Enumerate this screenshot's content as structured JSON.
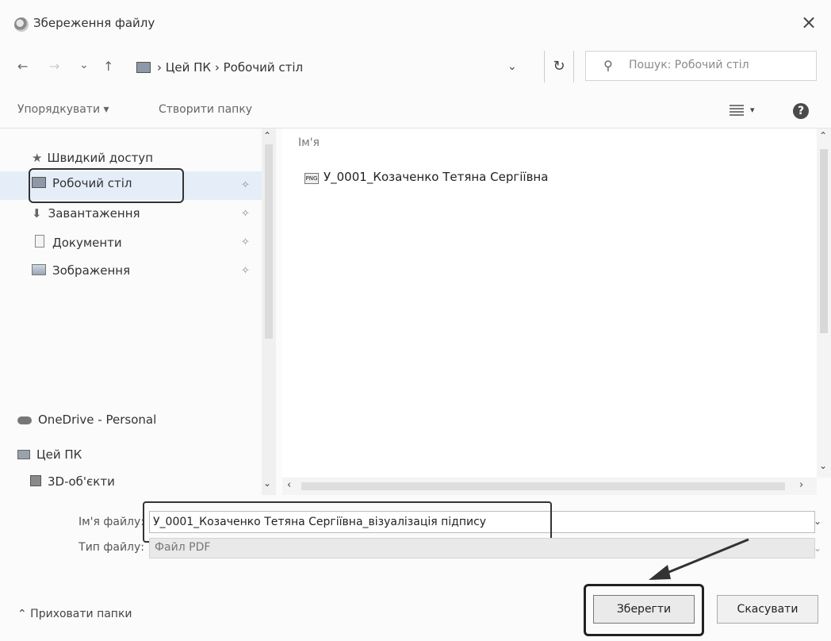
{
  "window": {
    "title": "Збереження файлу",
    "close_glyph": "×"
  },
  "nav": {
    "back_glyph": "←",
    "forward_glyph": "→",
    "recent_glyph": "⌄",
    "up_glyph": "↑",
    "path_text": "› Цей ПК › Робочий стіл",
    "path_dropdown_glyph": "⌄",
    "refresh_glyph": "↻"
  },
  "search": {
    "placeholder": "Пошук: Робочий стіл",
    "icon_glyph": "⚲"
  },
  "toolbar": {
    "organize_label": "Упорядкувати ▾",
    "new_folder_label": "Створити папку",
    "view_dropdown_glyph": "▾",
    "help_glyph": "?"
  },
  "navpane": {
    "quick_access": "Швидкий доступ",
    "items": [
      {
        "label": "Робочий стіл"
      },
      {
        "label": "Завантаження"
      },
      {
        "label": "Документи"
      },
      {
        "label": "Зображення"
      }
    ],
    "pin_glyph": "✧",
    "onedrive": "OneDrive - Personal",
    "this_pc": "Цей ПК",
    "objects_3d": "3D-об'єкти",
    "scroll_up_glyph": "⌃",
    "scroll_down_glyph": "⌄"
  },
  "filelist": {
    "column_name": "Ім'я",
    "files": [
      {
        "name": "У_0001_Козаченко Тетяна Сергіївна",
        "icon_text": "PNG"
      }
    ],
    "scroll_up_glyph": "⌃",
    "scroll_down_glyph": "⌄",
    "scroll_left_glyph": "‹",
    "scroll_right_glyph": "›"
  },
  "form": {
    "filename_label": "Ім'я файлу:",
    "filename_value": "У_0001_Козаченко Тетяна Сергіївна_візуалізація підпису",
    "filetype_label": "Тип файлу:",
    "filetype_value": "Файл PDF",
    "dropdown_glyph": "⌄"
  },
  "footer": {
    "hide_folders": "⌃ Приховати папки",
    "save_label": "Зберегти",
    "cancel_label": "Скасувати"
  }
}
